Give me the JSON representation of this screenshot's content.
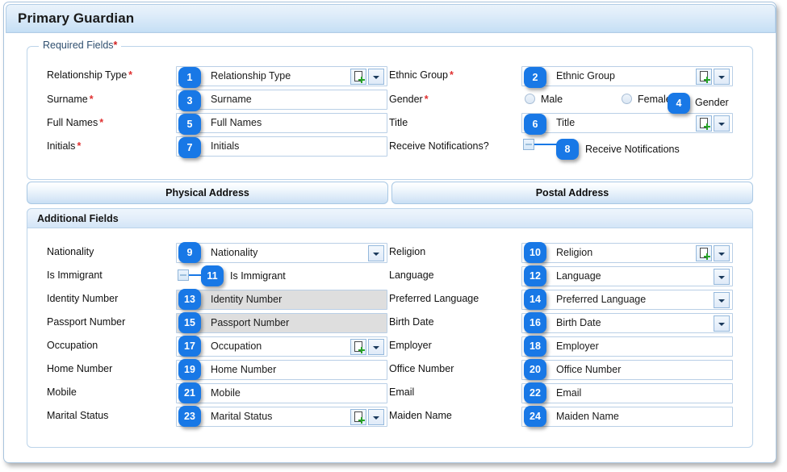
{
  "window": {
    "title": "Primary Guardian"
  },
  "required_section": {
    "legend": "Required Fields",
    "legend_asterisk": "*",
    "rows": [
      {
        "label": "Relationship Type",
        "required": "*",
        "value": "Relationship Type",
        "badge": "1",
        "control": "lookup"
      },
      {
        "label": "Surname",
        "required": "*",
        "value": "Surname",
        "badge": "3",
        "control": "text"
      },
      {
        "label": "Full Names",
        "required": "*",
        "value": "Full Names",
        "badge": "5",
        "control": "text"
      },
      {
        "label": "Initials",
        "required": "*",
        "value": "Initials",
        "badge": "7",
        "control": "text"
      }
    ],
    "right_rows": [
      {
        "label": "Ethnic Group",
        "required": "*",
        "value": "Ethnic Group",
        "badge": "2",
        "control": "lookup"
      },
      {
        "label": "Gender",
        "required": "*",
        "value": "Gender",
        "badge": "4",
        "control": "radio"
      },
      {
        "label": "Title",
        "required": "",
        "value": "Title",
        "badge": "6",
        "control": "lookup"
      },
      {
        "label": "Receive Notifications?",
        "required": "",
        "value": "Receive Notifications",
        "badge": "8",
        "control": "checkbox"
      }
    ],
    "gender_options": [
      {
        "label": "Male",
        "selected": false
      },
      {
        "label": "Female",
        "selected": false
      }
    ]
  },
  "address_tabs": [
    {
      "label": "Physical Address",
      "active": false
    },
    {
      "label": "Postal Address",
      "active": false
    }
  ],
  "additional_section": {
    "header": "Additional Fields",
    "left_rows": [
      {
        "label": "Nationality",
        "value": "Nationality",
        "badge": "9",
        "control": "dropdown"
      },
      {
        "label": "Is Immigrant",
        "value": "Is Immigrant",
        "badge": "11",
        "control": "checkbox"
      },
      {
        "label": "Identity Number",
        "value": "Identity Number",
        "badge": "13",
        "control": "text-disabled"
      },
      {
        "label": "Passport Number",
        "value": "Passport Number",
        "badge": "15",
        "control": "text-disabled"
      },
      {
        "label": "Occupation",
        "value": "Occupation",
        "badge": "17",
        "control": "lookup"
      },
      {
        "label": "Home Number",
        "value": "Home Number",
        "badge": "19",
        "control": "text"
      },
      {
        "label": "Mobile",
        "value": "Mobile",
        "badge": "21",
        "control": "text"
      },
      {
        "label": "Marital Status",
        "value": "Marital Status",
        "badge": "23",
        "control": "lookup"
      }
    ],
    "right_rows": [
      {
        "label": "Religion",
        "value": "Religion",
        "badge": "10",
        "control": "lookup"
      },
      {
        "label": "Language",
        "value": "Language",
        "badge": "12",
        "control": "dropdown"
      },
      {
        "label": "Preferred Language",
        "value": "Preferred Language",
        "badge": "14",
        "control": "dropdown"
      },
      {
        "label": "Birth Date",
        "value": "Birth Date",
        "badge": "16",
        "control": "dropdown"
      },
      {
        "label": "Employer",
        "value": "Employer",
        "badge": "18",
        "control": "text"
      },
      {
        "label": "Office Number",
        "value": "Office Number",
        "badge": "20",
        "control": "text"
      },
      {
        "label": "Email",
        "value": "Email",
        "badge": "22",
        "control": "text"
      },
      {
        "label": "Maiden Name",
        "value": "Maiden Name",
        "badge": "24",
        "control": "text"
      }
    ]
  },
  "colors": {
    "badge_blue": "#1878e6",
    "required_asterisk": "#e03030",
    "header_blue": "#c7e0f5",
    "panel_border": "#bcd4ea",
    "disabled_field": "#dedede",
    "add_plus_green": "#27a327"
  }
}
